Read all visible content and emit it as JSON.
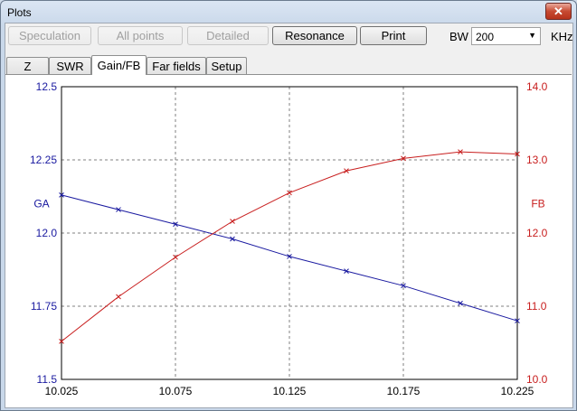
{
  "window": {
    "title": "Plots",
    "close_glyph": "✕"
  },
  "toolbar": {
    "buttons": [
      {
        "label": "Speculation",
        "enabled": false
      },
      {
        "label": "All points",
        "enabled": false
      },
      {
        "label": "Detailed",
        "enabled": false
      },
      {
        "label": "Resonance",
        "enabled": true
      },
      {
        "label": "Print",
        "enabled": true
      }
    ],
    "bw_label": "BW",
    "bw_value": "200",
    "bw_unit": "KHz"
  },
  "tabs": [
    {
      "label": "Z",
      "active": false
    },
    {
      "label": "SWR",
      "active": false
    },
    {
      "label": "Gain/FB",
      "active": true
    },
    {
      "label": "Far fields",
      "active": false
    },
    {
      "label": "Setup",
      "active": false
    }
  ],
  "colors": {
    "ga": "#1a1aa0",
    "fb": "#c81e1e",
    "grid": "#808080"
  },
  "chart_data": {
    "type": "line",
    "xlabel": "",
    "x_ticks": [
      "10.025",
      "10.075",
      "10.125",
      "10.175",
      "10.225"
    ],
    "xlim": [
      10.025,
      10.225
    ],
    "left_axis": {
      "label": "GA",
      "ylim": [
        11.5,
        12.5
      ],
      "ticks": [
        "11.5",
        "11.75",
        "12.0",
        "12.25",
        "12.5"
      ]
    },
    "right_axis": {
      "label": "FB",
      "ylim": [
        10.0,
        14.0
      ],
      "ticks": [
        "10.0",
        "11.0",
        "12.0",
        "13.0",
        "14.0"
      ]
    },
    "grid": true,
    "series": [
      {
        "name": "GA",
        "axis": "left",
        "x": [
          10.025,
          10.05,
          10.075,
          10.1,
          10.125,
          10.15,
          10.175,
          10.2,
          10.225
        ],
        "y": [
          12.13,
          12.08,
          12.03,
          11.98,
          11.92,
          11.87,
          11.82,
          11.76,
          11.7
        ]
      },
      {
        "name": "FB",
        "axis": "right",
        "x": [
          10.025,
          10.05,
          10.075,
          10.1,
          10.125,
          10.15,
          10.175,
          10.2,
          10.225
        ],
        "y": [
          10.52,
          11.13,
          11.67,
          12.16,
          12.55,
          12.85,
          13.02,
          13.11,
          13.08
        ]
      }
    ]
  }
}
